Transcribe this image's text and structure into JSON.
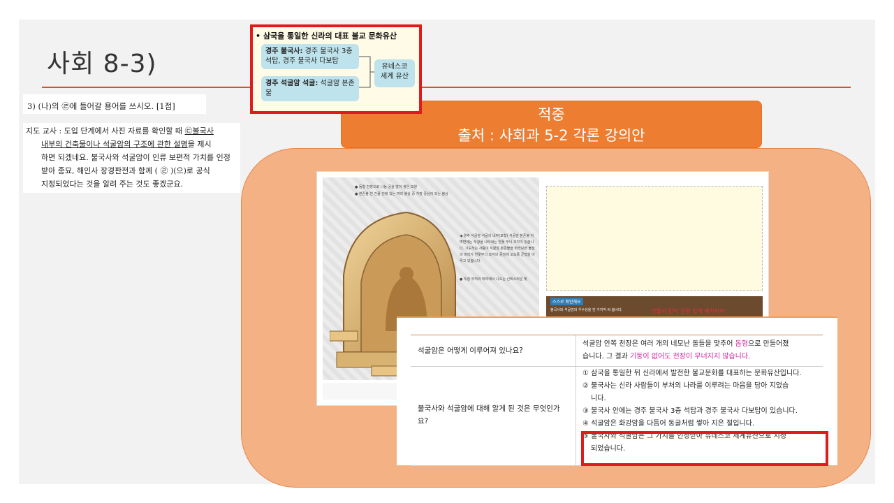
{
  "slide": {
    "title": "사회 8-3)"
  },
  "question": {
    "text": "3) (나)의 ㉣에 들어갈 용어를 쓰시오. [1점]"
  },
  "passage": {
    "line1_prefix": "지도 교사 : 도입 단계에서 사진 자료를 확인할 때 ",
    "line1_underlined": "㉢불국사",
    "line2_underlined": "내부의 건축물이나 석굴암의 구조에 관한 설명",
    "line2_suffix": "을 제시",
    "line3": "하면 되겠네요. 불국사와 석굴암이 인류 보편적 가치를 인정",
    "line4": "받아 종묘, 해인사 장경판전과 함께 (    ㉣    )(으)로 공식",
    "line5": "지정되었다는 것을 알려 주는 것도 좋겠군요."
  },
  "header": {
    "line1": "적중",
    "line2": "출처 : 사회과 5-2 각론 강의안"
  },
  "textbook": {
    "caption1": "● 돔형 천장으로 나눔 공을 많이 쌓은 모양",
    "caption2": "● 본존불 천 건물 안에 있는 여러 불상 중 가장 중심이 되는 불상",
    "side_note": "◀ 경주 석굴암 석굴의 내부(모형) 석굴암 본존불 뒤 벽면에는 두광을 나타내는 연꽃 무늬 조각이 있습니다. 기도하는 사람이 석굴암 본존불을 바라보면 불상의 머리가 연꽃무늬 조각의 중앙에 오도록 균형을 이루고 있습니다.",
    "side_note2": "● 두광 부처의 머리에서 나오는 신비스러운 빛",
    "box_title": "• 삼국을 통일한 신라의 대표 불교 문화유산",
    "item1_bold": "경주 불국사:",
    "item1_text": " 경주 불국사 3층 석탑, 경주 불국사 다보탑",
    "item2_bold": "경주 석굴암 석굴:",
    "item2_text": " 석굴암 본존불",
    "unesco": "유네스코 세계 유산",
    "check_tag": "스스로 확인해요",
    "check_q": "불국사와 석굴암의 우수성을 한 가지씩 써 봅시다.",
    "check_note": "건물과 탑이 균형 있게 배치되어"
  },
  "answer_table": {
    "rows": [
      {
        "question": "석굴암은 어떻게 이루어져 있나요?",
        "answer_lines": [
          {
            "text": "석굴암 안쪽 천장은 여러 개의 네모난 돌들을 맞추어 ",
            "highlight": "돔형",
            "after": "으로 만들어졌"
          },
          {
            "text": "습니다. 그 결과 ",
            "highlight": "기둥이 없어도 천장이 무너지지 않습니다.",
            "after": ""
          }
        ]
      },
      {
        "question": "불국사와 석굴암에 대해 알게 된 것은 무엇인가요?",
        "answer_lines": [
          "① 삼국을 통일한 뒤 신라에서 발전한 불교문화를 대표하는 문화유산입니다.",
          "② 불국사는 신라 사람들이 부처의 나라를 이루려는 마음을 담아 지었습",
          "니다.",
          "③ 불국사 안에는 경주 불국사 3층 석탑과 경주 불국사 다보탑이 있습니다.",
          "④ 석굴암은 화강암을 다듬어 동굴처럼 쌓아 지은 절입니다.",
          "⑤ 불국사와 석굴암은 그 가치를 인정받아 유네스코 세계유산으로 지정",
          "되었습니다."
        ]
      }
    ]
  },
  "colors": {
    "accent_orange": "#ed7d31",
    "peach": "#f4b183",
    "highlight_red": "#e01b1b",
    "title_rule": "#d9502a",
    "magenta": "#d0209e"
  }
}
